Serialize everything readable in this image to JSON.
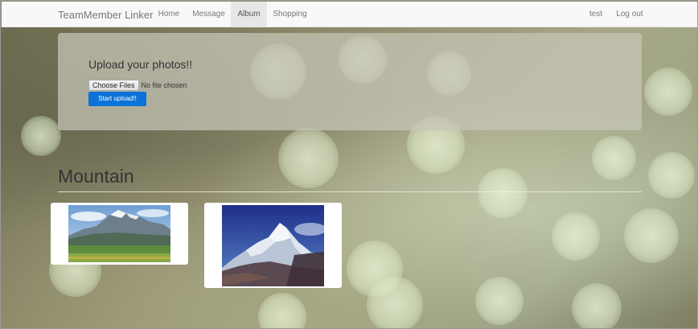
{
  "navbar": {
    "brand": "TeamMember Linker",
    "items": [
      {
        "label": "Home"
      },
      {
        "label": "Message"
      },
      {
        "label": "Album"
      },
      {
        "label": "Shopping"
      }
    ],
    "active": "Album",
    "right": [
      {
        "label": "test"
      },
      {
        "label": "Log out"
      }
    ]
  },
  "upload": {
    "title": "Upload your photos!!",
    "choose_label": "Choose Files",
    "file_status": "No file chosen",
    "start_label": "Start upload!!"
  },
  "album": {
    "title": "Mountain"
  },
  "colors": {
    "primary_button": "#0a72d8",
    "navbar_bg": "#f8f8f8",
    "active_tab_bg": "#e7e7e7"
  }
}
